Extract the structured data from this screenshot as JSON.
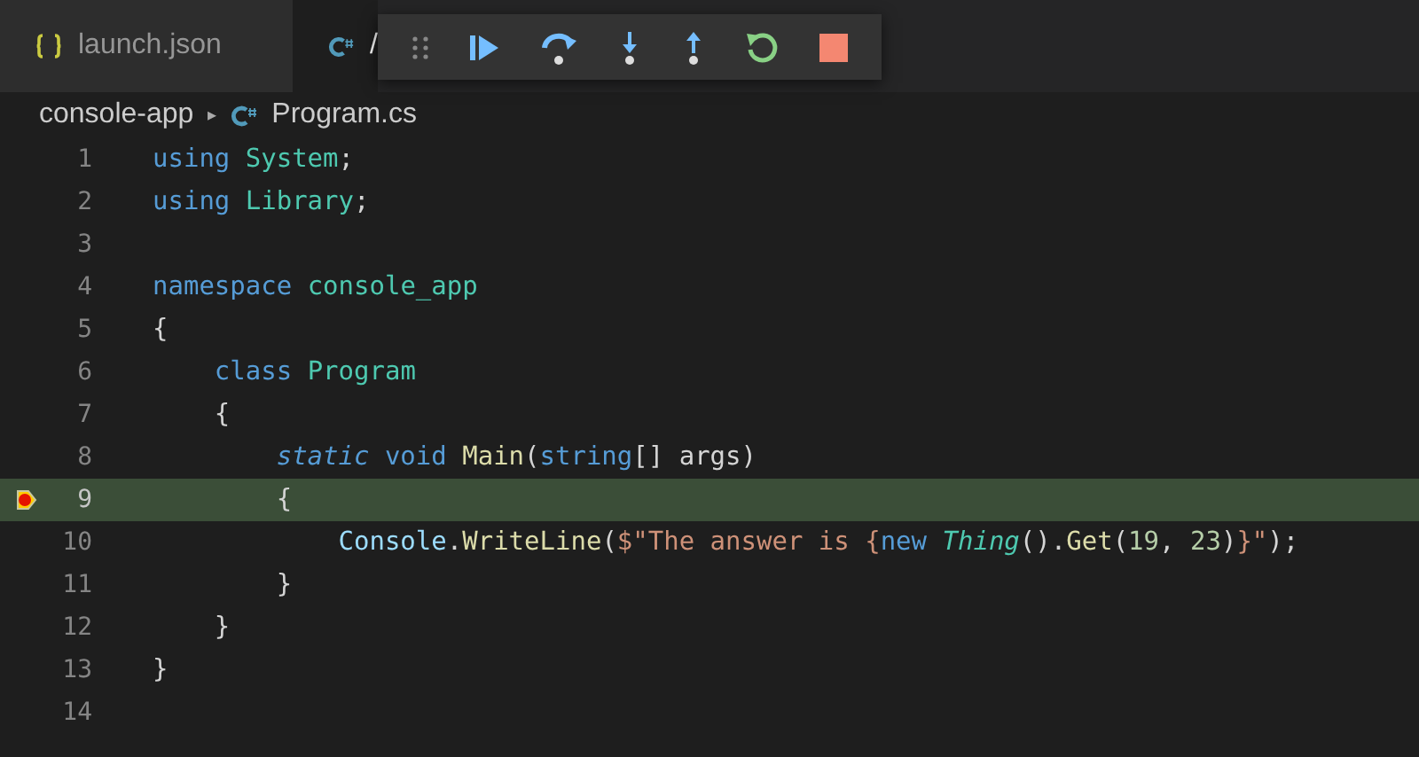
{
  "tabs": [
    {
      "label": "launch.json",
      "kind": "json",
      "selected": false
    },
    {
      "label": "/",
      "kind": "csharp",
      "selected": true
    }
  ],
  "breadcrumb": {
    "folder": "console-app",
    "separator": "▸",
    "file": "Program.cs"
  },
  "lines": [
    {
      "number": "1",
      "breakpoint": false,
      "current": false,
      "tokens": [
        {
          "text": "using ",
          "kind": "keyword"
        },
        {
          "text": "System",
          "kind": "type"
        },
        {
          "text": ";",
          "kind": "plain"
        }
      ]
    },
    {
      "number": "2",
      "breakpoint": false,
      "current": false,
      "tokens": [
        {
          "text": "using ",
          "kind": "keyword"
        },
        {
          "text": "Library",
          "kind": "type"
        },
        {
          "text": ";",
          "kind": "plain"
        }
      ]
    },
    {
      "number": "3",
      "breakpoint": false,
      "current": false
    },
    {
      "number": "4",
      "breakpoint": false,
      "current": false,
      "tokens": [
        {
          "text": "namespace ",
          "kind": "keyword"
        },
        {
          "text": "console_app",
          "kind": "type"
        }
      ]
    },
    {
      "number": "5",
      "breakpoint": false,
      "current": false,
      "tokens": [
        {
          "text": "{",
          "kind": "plain"
        }
      ]
    },
    {
      "number": "6",
      "breakpoint": false,
      "current": false,
      "tokens": [
        {
          "text": "    class ",
          "kind": "keyword"
        },
        {
          "text": "Program",
          "kind": "type"
        }
      ]
    },
    {
      "number": "7",
      "breakpoint": false,
      "current": false,
      "tokens": [
        {
          "text": "    {",
          "kind": "plain"
        }
      ]
    },
    {
      "number": "8",
      "breakpoint": false,
      "current": false,
      "tokens": [
        {
          "text": "        static",
          "kind": "keyword-italic"
        },
        {
          "text": " void ",
          "kind": "keyword"
        },
        {
          "text": "Main",
          "kind": "function"
        },
        {
          "text": "(",
          "kind": "plain"
        },
        {
          "text": "string",
          "kind": "keyword"
        },
        {
          "text": "[] args)",
          "kind": "plain"
        }
      ]
    },
    {
      "number": "9",
      "breakpoint": true,
      "current": true,
      "tokens": [
        {
          "text": "        {",
          "kind": "plain"
        }
      ]
    },
    {
      "number": "10",
      "breakpoint": false,
      "current": false,
      "tokens": [
        {
          "text": "            Console",
          "kind": "variable"
        },
        {
          "text": ".",
          "kind": "plain"
        },
        {
          "text": "WriteLine",
          "kind": "function"
        },
        {
          "text": "(",
          "kind": "plain"
        },
        {
          "text": "$\"The answer is {",
          "kind": "string"
        },
        {
          "text": "new ",
          "kind": "keyword"
        },
        {
          "text": "Thing",
          "kind": "type-italic"
        },
        {
          "text": "().",
          "kind": "plain"
        },
        {
          "text": "Get",
          "kind": "function"
        },
        {
          "text": "(",
          "kind": "plain"
        },
        {
          "text": "19",
          "kind": "number"
        },
        {
          "text": ", ",
          "kind": "plain"
        },
        {
          "text": "23",
          "kind": "number"
        },
        {
          "text": ")",
          "kind": "plain"
        },
        {
          "text": "}\"",
          "kind": "string"
        },
        {
          "text": ");",
          "kind": "plain"
        }
      ]
    },
    {
      "number": "11",
      "breakpoint": false,
      "current": false,
      "tokens": [
        {
          "text": "        }",
          "kind": "plain"
        }
      ]
    },
    {
      "number": "12",
      "breakpoint": false,
      "current": false,
      "tokens": [
        {
          "text": "    }",
          "kind": "plain"
        }
      ]
    },
    {
      "number": "13",
      "breakpoint": false,
      "current": false,
      "tokens": [
        {
          "text": "}",
          "kind": "plain"
        }
      ]
    },
    {
      "number": "14",
      "breakpoint": false,
      "current": false
    }
  ]
}
